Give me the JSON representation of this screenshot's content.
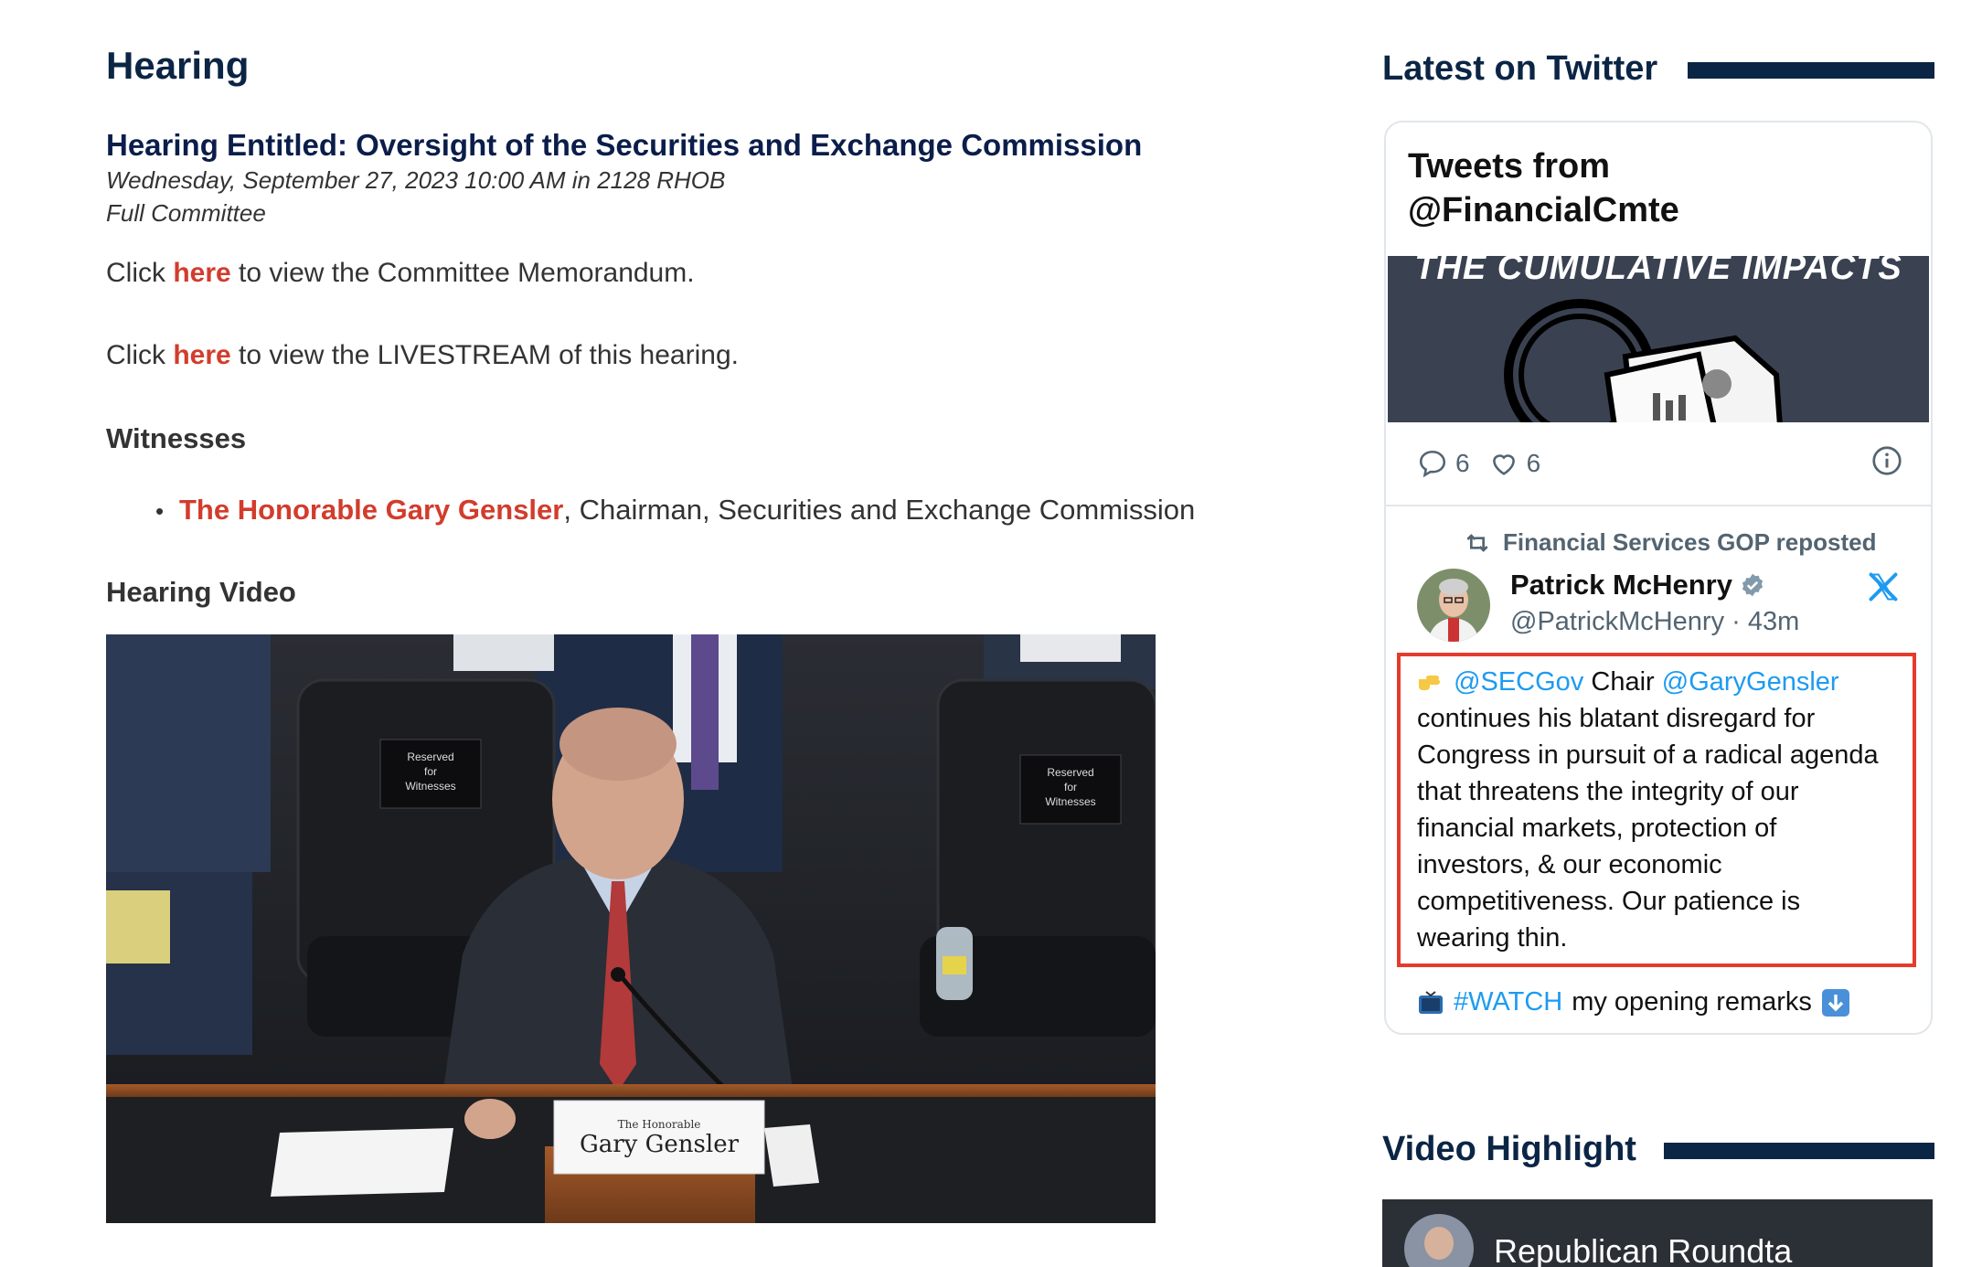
{
  "page": {
    "heading": "Hearing"
  },
  "hearing": {
    "title": "Hearing Entitled: Oversight of the Securities and Exchange Commission",
    "date": "Wednesday, September 27, 2023 10:00 AM in 2128 RHOB",
    "committee": "Full Committee",
    "memo_prefix": "Click",
    "memo_link": "here",
    "memo_suffix": " to view the Committee Memorandum.",
    "live_prefix": "Click",
    "live_link": "here",
    "live_suffix": " to view the LIVESTREAM of this hearing.",
    "witnesses_heading": "Witnesses",
    "witnesses": [
      {
        "name": "The Honorable Gary Gensler",
        "role": ", Chairman, Securities and Exchange Commission"
      }
    ],
    "video_heading": "Hearing Video",
    "video": {
      "placard_left": [
        "Reserved",
        "for",
        "Witnesses"
      ],
      "placard_right": [
        "Reserved",
        "for",
        "Witnesses"
      ],
      "nameplate_small": "The Honorable",
      "nameplate_name": "Gary Gensler"
    }
  },
  "sidebar": {
    "twitter_heading": "Latest on Twitter",
    "video_heading": "Video Highlight",
    "video_thumb_title": "Republican Roundta"
  },
  "tweet": {
    "header_line1": "Tweets from",
    "header_line2": "@FinancialCmte",
    "media_text": "THE CUMULATIVE IMPACTS",
    "reply_count": "6",
    "like_count": "6",
    "repost_label": "Financial Services GOP reposted",
    "author_name": "Patrick McHenry",
    "author_handle": "@PatrickMcHenry",
    "time": " · 43m",
    "mention_1": "@SECGov",
    "text_chair": " Chair ",
    "mention_2": "@GaryGensler",
    "text_body": " continues his blatant disregard for Congress in pursuit of a radical agenda that threatens the integrity of our financial markets, protection of investors, & our economic competitiveness. Our patience is wearing thin.",
    "watch_tag": "#WATCH",
    "watch_text": "my opening remarks",
    "colors": {
      "link": "#1d9bf0",
      "highlight_border": "#e43b2c"
    }
  },
  "colors": {
    "navy": "#0b2545",
    "link_red": "#d23c2c"
  },
  "icons": [
    "reply-icon",
    "heart-icon",
    "info-icon",
    "repost-icon",
    "verified-icon",
    "x-logo-icon",
    "point-right-icon",
    "tv-icon",
    "down-arrow-icon"
  ]
}
